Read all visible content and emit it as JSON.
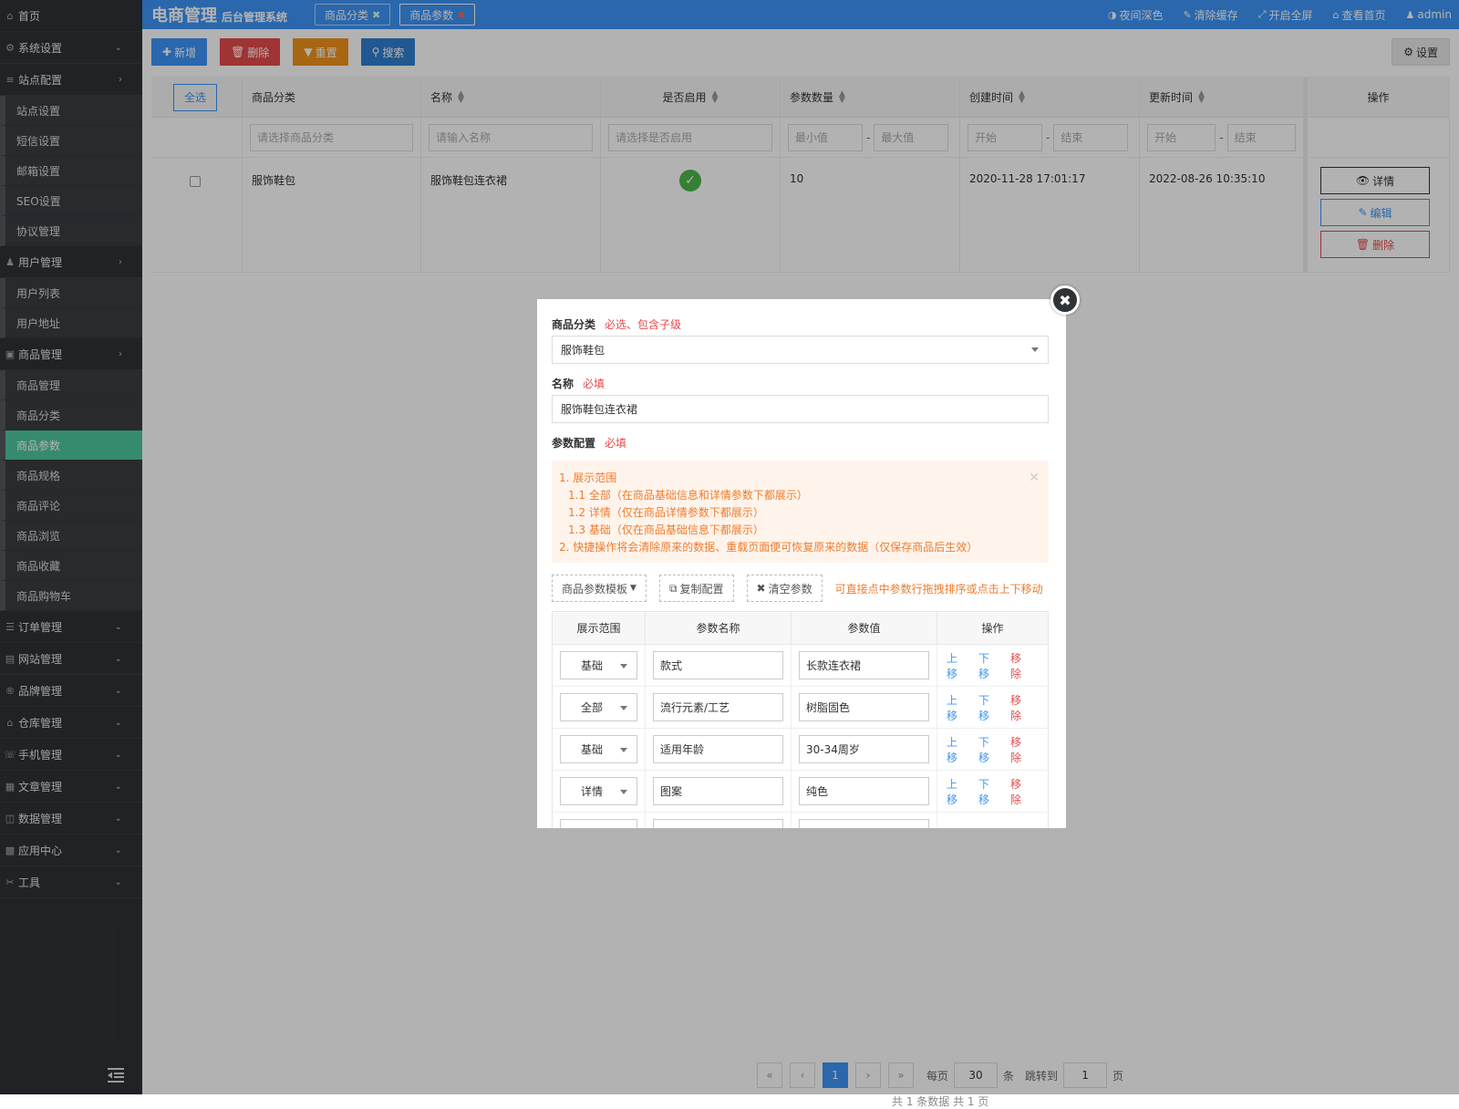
{
  "sidebar": {
    "home": "首页",
    "menu": [
      {
        "label": "系统设置",
        "icon": "gear-icon",
        "arrow": "⌄"
      },
      {
        "label": "站点配置",
        "icon": "sliders-icon",
        "arrow": "›",
        "children": [
          "站点设置",
          "短信设置",
          "邮箱设置",
          "SEO设置",
          "协议管理"
        ]
      },
      {
        "label": "用户管理",
        "icon": "user-icon",
        "arrow": "›",
        "children": [
          "用户列表",
          "用户地址"
        ]
      },
      {
        "label": "商品管理",
        "icon": "bag-icon",
        "arrow": "›",
        "children": [
          "商品管理",
          "商品分类",
          "商品参数",
          "商品规格",
          "商品评论",
          "商品浏览",
          "商品收藏",
          "商品购物车"
        ]
      },
      {
        "label": "订单管理",
        "icon": "order-icon",
        "arrow": "⌄"
      },
      {
        "label": "网站管理",
        "icon": "site-icon",
        "arrow": "⌄"
      },
      {
        "label": "品牌管理",
        "icon": "brand-icon",
        "arrow": "⌄"
      },
      {
        "label": "仓库管理",
        "icon": "warehouse-icon",
        "arrow": "⌄"
      },
      {
        "label": "手机管理",
        "icon": "phone-icon",
        "arrow": "⌄"
      },
      {
        "label": "文章管理",
        "icon": "article-icon",
        "arrow": "⌄"
      },
      {
        "label": "数据管理",
        "icon": "database-icon",
        "arrow": "⌄"
      },
      {
        "label": "应用中心",
        "icon": "apps-icon",
        "arrow": "⌄"
      },
      {
        "label": "工具",
        "icon": "tools-icon",
        "arrow": "⌄"
      }
    ],
    "active_item": "商品参数"
  },
  "header": {
    "title": "电商管理",
    "subtitle": "后台管理系统",
    "tabs": [
      {
        "label": "商品分类"
      },
      {
        "label": "商品参数"
      }
    ],
    "tools": {
      "night": "夜间深色",
      "cache": "清除缓存",
      "fullscreen": "开启全屏",
      "home": "查看首页",
      "user": "admin"
    }
  },
  "toolbar": {
    "add": "新增",
    "delete": "删除",
    "reset": "重置",
    "search": "搜索",
    "settings": "设置"
  },
  "table": {
    "select_all": "全选",
    "columns": [
      "商品分类",
      "名称",
      "是否启用",
      "参数数量",
      "创建时间",
      "更新时间",
      "操作"
    ],
    "filters": {
      "category": "请选择商品分类",
      "name": "请输入名称",
      "enabled": "请选择是否启用",
      "min": "最小值",
      "max": "最大值",
      "start": "开始",
      "end": "结束",
      "sep": "-"
    },
    "rows": [
      {
        "category": "服饰鞋包",
        "name": "服饰鞋包连衣裙",
        "enabled": true,
        "count": "10",
        "created": "2020-11-28 17:01:17",
        "updated": "2022-08-26 10:35:10"
      }
    ],
    "actions": {
      "detail": "详情",
      "edit": "编辑",
      "delete": "删除"
    }
  },
  "pagination": {
    "first": "«",
    "prev": "‹",
    "current": "1",
    "next": "›",
    "last": "»",
    "per_page_label": "每页",
    "per_page": "30",
    "per_page_unit": "条",
    "jump_label": "跳转到",
    "jump_value": "1",
    "jump_unit": "页",
    "summary": "共 1 条数据   共 1 页"
  },
  "modal": {
    "category_label": "商品分类",
    "category_req": "必选、包含子级",
    "category_value": "服饰鞋包",
    "name_label": "名称",
    "name_req": "必填",
    "name_value": "服饰鞋包连衣裙",
    "config_label": "参数配置",
    "config_req": "必填",
    "notice": [
      "1. 展示范围",
      "1.1 全部（在商品基础信息和详情参数下都展示）",
      "1.2 详情（仅在商品详情参数下都展示）",
      "1.3 基础（仅在商品基础信息下都展示）",
      "2. 快捷操作将会清除原来的数据、重载页面便可恢复原来的数据（仅保存商品后生效）"
    ],
    "template_btn": "商品参数模板",
    "copy_btn": "复制配置",
    "clear_btn": "清空参数",
    "hint": "可直接点中参数行拖拽排序或点击上下移动",
    "param_columns": [
      "展示范围",
      "参数名称",
      "参数值",
      "操作"
    ],
    "params": [
      {
        "scope": "基础",
        "name": "款式",
        "value": "长款连衣裙"
      },
      {
        "scope": "全部",
        "name": "流行元素/工艺",
        "value": "树脂固色"
      },
      {
        "scope": "基础",
        "name": "适用年龄",
        "value": "30-34周岁"
      },
      {
        "scope": "详情",
        "name": "图案",
        "value": "纯色"
      }
    ],
    "param_actions": {
      "up": "上移",
      "down": "下移",
      "remove": "移除"
    },
    "close": "✖"
  }
}
